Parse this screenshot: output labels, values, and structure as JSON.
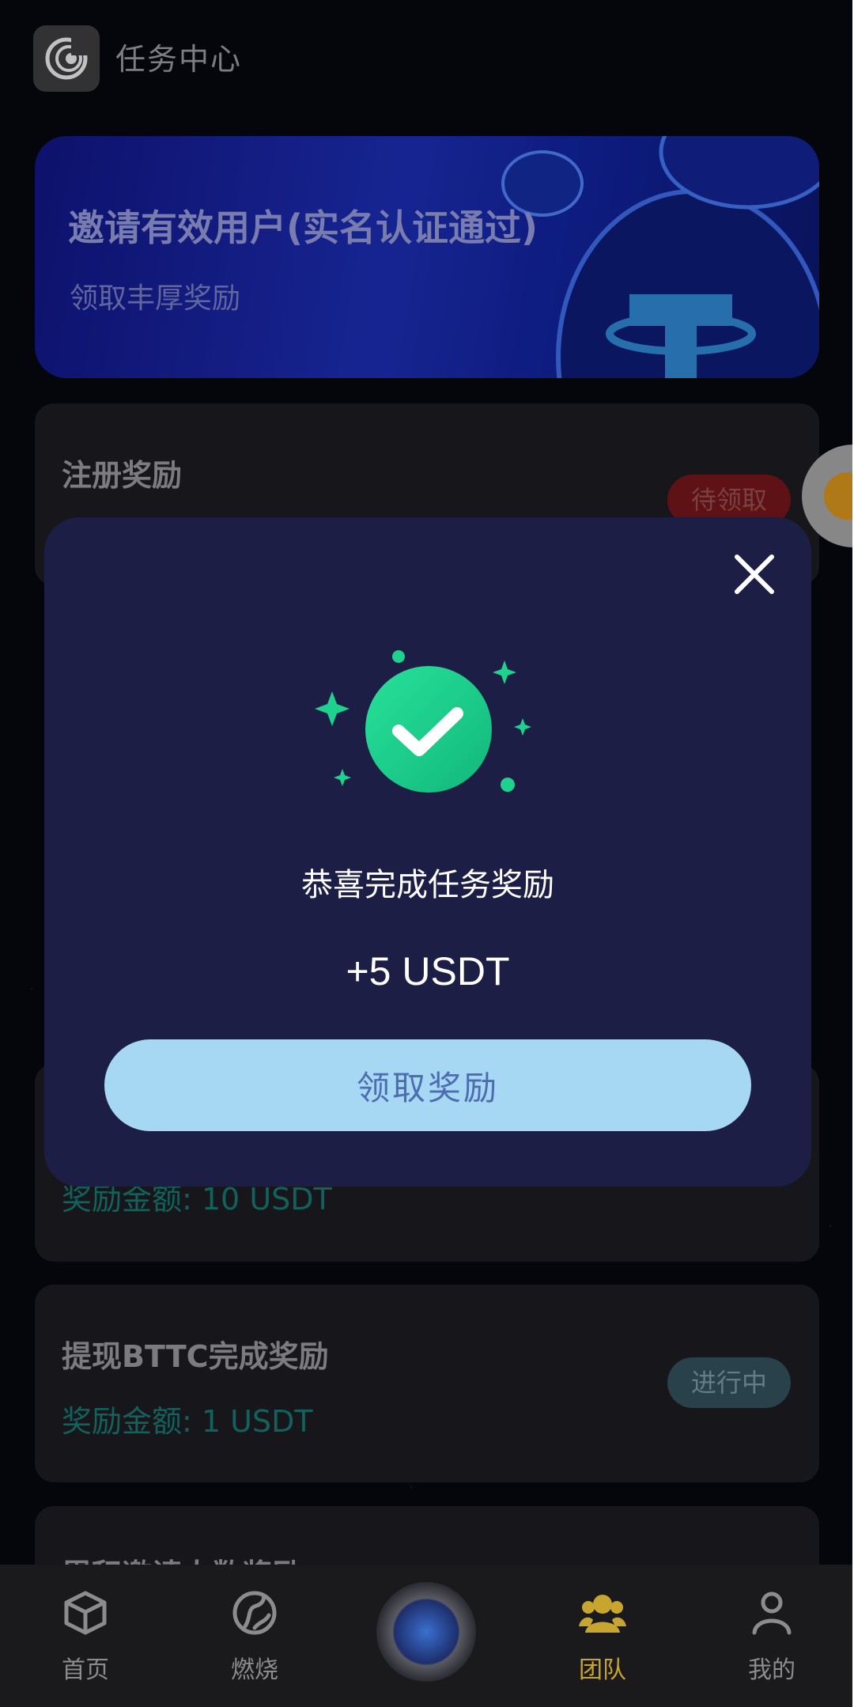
{
  "header": {
    "title": "任务中心",
    "logo_icon": "app-logo-icon"
  },
  "banner": {
    "title": "邀请有效用户(实名认证通过)",
    "subtitle": "领取丰厚奖励"
  },
  "tasks": [
    {
      "title": "注册奖励",
      "status": "待领取"
    },
    {
      "title": "",
      "amount": "奖励金额: 10 USDT"
    },
    {
      "title": "提现BTTC完成奖励",
      "amount": "奖励金额: 1 USDT",
      "status": "进行中"
    },
    {
      "title": "累积邀请人数奖励"
    }
  ],
  "modal": {
    "title": "恭喜完成任务奖励",
    "amount": "+5 USDT",
    "button_label": "领取奖励"
  },
  "nav": {
    "items": [
      {
        "label": "首页",
        "icon": "cube-icon"
      },
      {
        "label": "燃烧",
        "icon": "burn-icon"
      },
      {
        "label": "",
        "icon": "center-orb-icon"
      },
      {
        "label": "团队",
        "icon": "team-icon",
        "active": true
      },
      {
        "label": "我的",
        "icon": "profile-icon"
      }
    ]
  },
  "colors": {
    "background": "#05070d",
    "modal": "#1d1e46",
    "button": "#a6d8f4",
    "button_text": "#4d6db0",
    "success_green": "#1ed28e",
    "amount_teal": "#156f6a",
    "nav_active": "#c8a52f"
  }
}
